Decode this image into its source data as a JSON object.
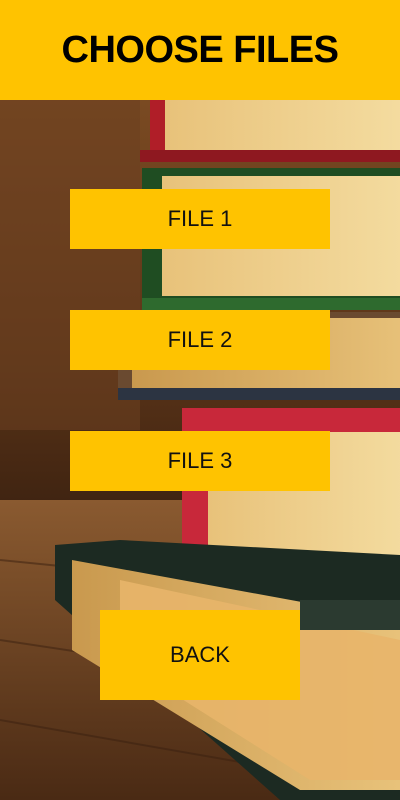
{
  "header": {
    "title": "CHOOSE FILES"
  },
  "buttons": {
    "file1": "FILE 1",
    "file2": "FILE 2",
    "file3": "FILE 3",
    "back": "BACK"
  },
  "colors": {
    "accent": "#FFC300",
    "text": "#111111"
  },
  "background": {
    "subject": "stack-of-books-photo"
  }
}
